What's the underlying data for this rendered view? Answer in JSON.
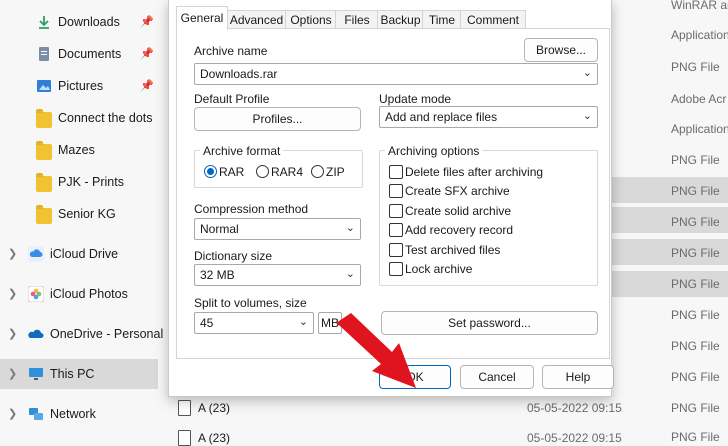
{
  "nav": {
    "items": [
      {
        "label": "Downloads",
        "icon": "download-icon",
        "pinned": true
      },
      {
        "label": "Documents",
        "icon": "document-icon",
        "pinned": true
      },
      {
        "label": "Pictures",
        "icon": "pictures-icon",
        "pinned": true
      },
      {
        "label": "Connect the dots",
        "icon": "folder-icon"
      },
      {
        "label": "Mazes",
        "icon": "folder-icon"
      },
      {
        "label": "PJK - Prints",
        "icon": "folder-icon"
      },
      {
        "label": "Senior KG",
        "icon": "folder-icon"
      },
      {
        "label": "iCloud Drive",
        "icon": "icloud-drive-icon"
      },
      {
        "label": "iCloud Photos",
        "icon": "icloud-photos-icon"
      },
      {
        "label": "OneDrive - Personal",
        "icon": "onedrive-icon"
      },
      {
        "label": "This PC",
        "icon": "this-pc-icon",
        "selected": true
      },
      {
        "label": "Network",
        "icon": "network-icon"
      }
    ]
  },
  "file_types": [
    "WinRAR ar",
    "Application",
    "PNG File",
    "Adobe Acr",
    "Application",
    "PNG File",
    "PNG File",
    "PNG File",
    "PNG File",
    "PNG File",
    "PNG File",
    "PNG File",
    "PNG File",
    "PNG File",
    "PNG File",
    "PNG File",
    "PNG File"
  ],
  "files": [
    {
      "name": "A (23)",
      "date": "05-05-2022 09:15"
    },
    {
      "name": "A (23)",
      "date": "05-05-2022 09:15"
    }
  ],
  "dialog": {
    "tabs": [
      "General",
      "Advanced",
      "Options",
      "Files",
      "Backup",
      "Time",
      "Comment"
    ],
    "archive_name_label": "Archive name",
    "browse_label": "Browse...",
    "archive_name_value": "Downloads.rar",
    "default_profile_label": "Default Profile",
    "profiles_label": "Profiles...",
    "update_mode_label": "Update mode",
    "update_mode_value": "Add and replace files",
    "archive_format_label": "Archive format",
    "formats": [
      "RAR",
      "RAR4",
      "ZIP"
    ],
    "selected_format": "RAR",
    "compression_label": "Compression method",
    "compression_value": "Normal",
    "dictionary_label": "Dictionary size",
    "dictionary_value": "32 MB",
    "split_label": "Split to volumes, size",
    "split_value": "45",
    "split_unit": "MB",
    "archiving_options_label": "Archiving options",
    "options": [
      "Delete files after archiving",
      "Create SFX archive",
      "Create solid archive",
      "Add recovery record",
      "Test archived files",
      "Lock archive"
    ],
    "set_password_label": "Set password...",
    "ok_label": "OK",
    "cancel_label": "Cancel",
    "help_label": "Help"
  },
  "colors": {
    "accent": "#0067c0",
    "arrow": "#e0141e",
    "folder": "#f1c232"
  }
}
